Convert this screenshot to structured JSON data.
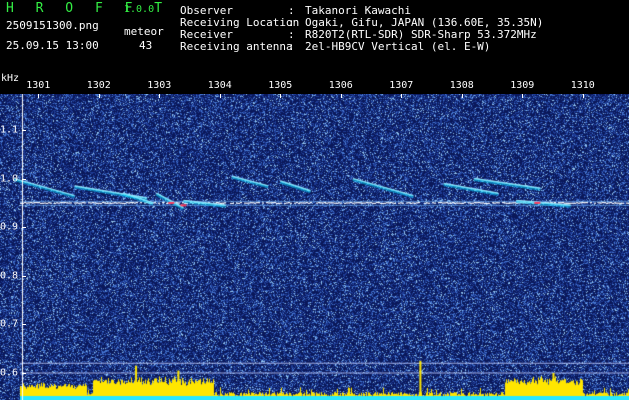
{
  "header": {
    "logo": "H R O F F T",
    "version": "1.0.0",
    "filename": "2509151300.png",
    "datetime": "25.09.15 13:00",
    "meteor_label": "meteor",
    "meteor_count": "43",
    "fields": [
      {
        "key": "Observer",
        "value": "Takanori Kawachi"
      },
      {
        "key": "Receiving Location",
        "value": "Ogaki, Gifu, JAPAN (136.60E, 35.35N)"
      },
      {
        "key": "Receiver",
        "value": "R820T2(RTL-SDR) SDR-Sharp 53.372MHz"
      },
      {
        "key": "Receiving antenna",
        "value": "2el-HB9CV Vertical (el. E-W)"
      }
    ],
    "colon": ":"
  },
  "axis": {
    "unit": "kHz",
    "x_labels": [
      "1301",
      "1302",
      "1303",
      "1304",
      "1305",
      "1306",
      "1307",
      "1308",
      "1309",
      "1310"
    ],
    "y_labels": [
      "1.1",
      "1.0",
      "0.9",
      "0.8",
      "0.7",
      "0.6"
    ]
  },
  "colors": {
    "background": "#000000",
    "plot_bg": "#0b1a55",
    "echo": "#e8f0ff",
    "carrier": "#ffffff",
    "activity_bar": "#ffe600",
    "baseline": "#28e8ff",
    "logo": "#33ee44"
  },
  "chart_data": {
    "type": "heatmap",
    "title": "",
    "xlabel": "",
    "ylabel": "kHz",
    "xlim": [
      1300.5,
      1310.1
    ],
    "ylim": [
      0.56,
      1.15
    ],
    "carrier_khz": 0.95,
    "echo_traces": [
      {
        "x": [
          1300.6,
          1301.6
        ],
        "y": [
          1.0,
          0.965
        ]
      },
      {
        "x": [
          1301.6,
          1302.8
        ],
        "y": [
          0.985,
          0.96
        ]
      },
      {
        "x": [
          1302.4,
          1302.9
        ],
        "y": [
          0.97,
          0.95
        ]
      },
      {
        "x": [
          1302.95,
          1303.4
        ],
        "y": [
          0.97,
          0.94
        ]
      },
      {
        "x": [
          1303.4,
          1304.1
        ],
        "y": [
          0.955,
          0.945
        ]
      },
      {
        "x": [
          1304.2,
          1304.8
        ],
        "y": [
          1.005,
          0.985
        ]
      },
      {
        "x": [
          1305.0,
          1305.5
        ],
        "y": [
          0.995,
          0.975
        ]
      },
      {
        "x": [
          1306.2,
          1307.2
        ],
        "y": [
          1.0,
          0.965
        ]
      },
      {
        "x": [
          1307.7,
          1308.6
        ],
        "y": [
          0.99,
          0.97
        ]
      },
      {
        "x": [
          1308.2,
          1309.3
        ],
        "y": [
          1.0,
          0.98
        ]
      },
      {
        "x": [
          1308.9,
          1309.8
        ],
        "y": [
          0.955,
          0.945
        ]
      }
    ],
    "activity_peaks": [
      {
        "x": 1302.6,
        "y": 0.615
      },
      {
        "x": 1303.3,
        "y": 0.605
      },
      {
        "x": 1307.3,
        "y": 0.625
      },
      {
        "x": 1309.5,
        "y": 0.6
      }
    ]
  }
}
